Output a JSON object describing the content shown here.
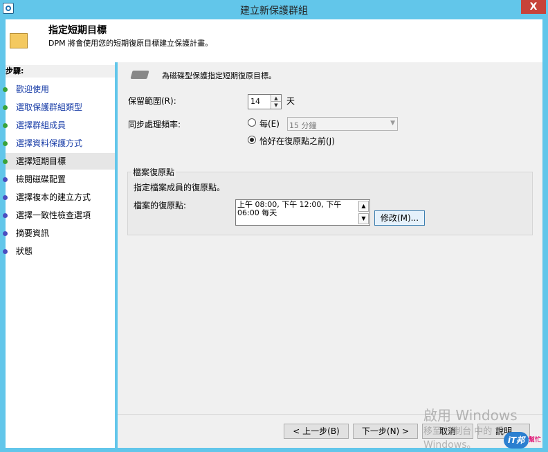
{
  "window": {
    "title": "建立新保護群組",
    "close_label": "X"
  },
  "header": {
    "title": "指定短期目標",
    "subtitle": "DPM 將會使用您的短期復原目標建立保護計畫。"
  },
  "steps": {
    "label": "步驟:",
    "items": [
      {
        "label": "歡迎使用",
        "status": "done"
      },
      {
        "label": "選取保護群組類型",
        "status": "done"
      },
      {
        "label": "選擇群組成員",
        "status": "done"
      },
      {
        "label": "選擇資料保護方式",
        "status": "done"
      },
      {
        "label": "選擇短期目標",
        "status": "current"
      },
      {
        "label": "檢閱磁碟配置",
        "status": "pending"
      },
      {
        "label": "選擇複本的建立方式",
        "status": "pending"
      },
      {
        "label": "選擇一致性檢查選項",
        "status": "pending"
      },
      {
        "label": "摘要資訊",
        "status": "pending"
      },
      {
        "label": "狀態",
        "status": "pending"
      }
    ]
  },
  "main": {
    "disk_caption": "為磁碟型保護指定短期復原目標。",
    "retention_label": "保留範圍(R):",
    "retention_value": "14",
    "retention_unit": "天",
    "sync_label": "同步處理頻率:",
    "sync_every_label": "每(E)",
    "sync_every_value": "15 分鐘",
    "sync_before_label": "恰好在復原點之前(J)",
    "sync_selected": "before",
    "file_rp": {
      "group_title": "檔案復原點",
      "description": "指定檔案成員的復原點。",
      "label": "檔案的復原點:",
      "value": "上午 08:00, 下午 12:00, 下午 06:00 每天",
      "modify_label": "修改(M)..."
    }
  },
  "footer": {
    "back_label": "< 上一步(B)",
    "next_label": "下一步(N) >",
    "cancel_label": "取消",
    "help_label": "說明"
  },
  "watermark": {
    "line1": "啟用 Windows",
    "line2": "移至 控制台 中的 系",
    "line3": "Windows。"
  },
  "logo": {
    "text": "iT邦",
    "sub": "幫忙"
  },
  "colors": {
    "done": "#3aa33a",
    "pending": "#4b4ec0",
    "title_bar": "#62c6ea"
  }
}
